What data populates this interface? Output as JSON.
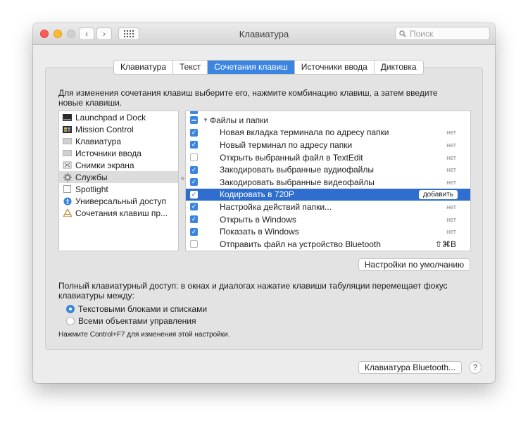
{
  "window": {
    "title": "Клавиатура"
  },
  "search": {
    "placeholder": "Поиск"
  },
  "tabs": [
    {
      "label": "Клавиатура",
      "active": false
    },
    {
      "label": "Текст",
      "active": false
    },
    {
      "label": "Сочетания клавиш",
      "active": true
    },
    {
      "label": "Источники ввода",
      "active": false
    },
    {
      "label": "Диктовка",
      "active": false
    }
  ],
  "description": "Для изменения сочетания клавиш выберите его, нажмите комбинацию клавиш, а затем введите новые клавиши.",
  "categories": [
    {
      "label": "Launchpad и Dock",
      "icon": "dock-icon"
    },
    {
      "label": "Mission Control",
      "icon": "mission-control-icon"
    },
    {
      "label": "Клавиатура",
      "icon": "keyboard-icon"
    },
    {
      "label": "Источники ввода",
      "icon": "input-sources-icon"
    },
    {
      "label": "Снимки экрана",
      "icon": "screenshot-icon"
    },
    {
      "label": "Службы",
      "icon": "gear-icon",
      "selected": true
    },
    {
      "label": "Spotlight",
      "icon": "spotlight-icon"
    },
    {
      "label": "Универсальный доступ",
      "icon": "accessibility-icon"
    },
    {
      "label": "Сочетания клавиш пр...",
      "icon": "app-shortcuts-icon"
    }
  ],
  "shortcuts": {
    "group_label": "Файлы и папки",
    "items": [
      {
        "label": "Новая вкладка терминала по адресу папки",
        "checked": true,
        "shortcut": "нет"
      },
      {
        "label": "Новый терминал по адресу папки",
        "checked": true,
        "shortcut": "нет"
      },
      {
        "label": "Открыть выбранный файл в TextEdit",
        "checked": false,
        "shortcut": "нет"
      },
      {
        "label": "Закодировать выбранные аудиофайлы",
        "checked": true,
        "shortcut": "нет"
      },
      {
        "label": "Закодировать выбранные видеофайлы",
        "checked": true,
        "shortcut": "нет"
      },
      {
        "label": "Кодировать в 720P",
        "checked": true,
        "selected": true,
        "action": "добавить"
      },
      {
        "label": "Настройка действий папки...",
        "checked": true,
        "shortcut": "нет"
      },
      {
        "label": "Открыть в Windows",
        "checked": true,
        "shortcut": "нет"
      },
      {
        "label": "Показать в Windows",
        "checked": true,
        "shortcut": "нет"
      },
      {
        "label": "Отправить файл на устройство Bluetooth",
        "checked": false,
        "shortcut": "⇧⌘B"
      }
    ]
  },
  "defaults_button": "Настройки по умолчанию",
  "full_access": {
    "text": "Полный клавиатурный доступ: в окнах и диалогах нажатие клавиши табуляции перемещает фокус клавиатуры между:",
    "options": [
      {
        "label": "Текстовыми блоками и списками",
        "selected": true
      },
      {
        "label": "Всеми объектами управления",
        "selected": false
      }
    ],
    "hint": "Нажмите Control+F7 для изменения этой настройки."
  },
  "bluetooth_button": "Клавиатура Bluetooth...",
  "help_label": "?",
  "accent_color": "#3b85e0"
}
